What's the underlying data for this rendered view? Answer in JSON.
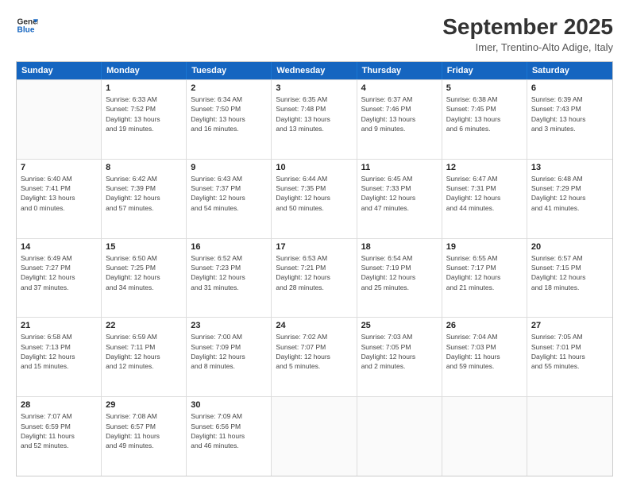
{
  "header": {
    "logo_line1": "General",
    "logo_line2": "Blue",
    "title": "September 2025",
    "subtitle": "Imer, Trentino-Alto Adige, Italy"
  },
  "weekdays": [
    "Sunday",
    "Monday",
    "Tuesday",
    "Wednesday",
    "Thursday",
    "Friday",
    "Saturday"
  ],
  "rows": [
    [
      {
        "day": "",
        "info": ""
      },
      {
        "day": "1",
        "info": "Sunrise: 6:33 AM\nSunset: 7:52 PM\nDaylight: 13 hours\nand 19 minutes."
      },
      {
        "day": "2",
        "info": "Sunrise: 6:34 AM\nSunset: 7:50 PM\nDaylight: 13 hours\nand 16 minutes."
      },
      {
        "day": "3",
        "info": "Sunrise: 6:35 AM\nSunset: 7:48 PM\nDaylight: 13 hours\nand 13 minutes."
      },
      {
        "day": "4",
        "info": "Sunrise: 6:37 AM\nSunset: 7:46 PM\nDaylight: 13 hours\nand 9 minutes."
      },
      {
        "day": "5",
        "info": "Sunrise: 6:38 AM\nSunset: 7:45 PM\nDaylight: 13 hours\nand 6 minutes."
      },
      {
        "day": "6",
        "info": "Sunrise: 6:39 AM\nSunset: 7:43 PM\nDaylight: 13 hours\nand 3 minutes."
      }
    ],
    [
      {
        "day": "7",
        "info": "Sunrise: 6:40 AM\nSunset: 7:41 PM\nDaylight: 13 hours\nand 0 minutes."
      },
      {
        "day": "8",
        "info": "Sunrise: 6:42 AM\nSunset: 7:39 PM\nDaylight: 12 hours\nand 57 minutes."
      },
      {
        "day": "9",
        "info": "Sunrise: 6:43 AM\nSunset: 7:37 PM\nDaylight: 12 hours\nand 54 minutes."
      },
      {
        "day": "10",
        "info": "Sunrise: 6:44 AM\nSunset: 7:35 PM\nDaylight: 12 hours\nand 50 minutes."
      },
      {
        "day": "11",
        "info": "Sunrise: 6:45 AM\nSunset: 7:33 PM\nDaylight: 12 hours\nand 47 minutes."
      },
      {
        "day": "12",
        "info": "Sunrise: 6:47 AM\nSunset: 7:31 PM\nDaylight: 12 hours\nand 44 minutes."
      },
      {
        "day": "13",
        "info": "Sunrise: 6:48 AM\nSunset: 7:29 PM\nDaylight: 12 hours\nand 41 minutes."
      }
    ],
    [
      {
        "day": "14",
        "info": "Sunrise: 6:49 AM\nSunset: 7:27 PM\nDaylight: 12 hours\nand 37 minutes."
      },
      {
        "day": "15",
        "info": "Sunrise: 6:50 AM\nSunset: 7:25 PM\nDaylight: 12 hours\nand 34 minutes."
      },
      {
        "day": "16",
        "info": "Sunrise: 6:52 AM\nSunset: 7:23 PM\nDaylight: 12 hours\nand 31 minutes."
      },
      {
        "day": "17",
        "info": "Sunrise: 6:53 AM\nSunset: 7:21 PM\nDaylight: 12 hours\nand 28 minutes."
      },
      {
        "day": "18",
        "info": "Sunrise: 6:54 AM\nSunset: 7:19 PM\nDaylight: 12 hours\nand 25 minutes."
      },
      {
        "day": "19",
        "info": "Sunrise: 6:55 AM\nSunset: 7:17 PM\nDaylight: 12 hours\nand 21 minutes."
      },
      {
        "day": "20",
        "info": "Sunrise: 6:57 AM\nSunset: 7:15 PM\nDaylight: 12 hours\nand 18 minutes."
      }
    ],
    [
      {
        "day": "21",
        "info": "Sunrise: 6:58 AM\nSunset: 7:13 PM\nDaylight: 12 hours\nand 15 minutes."
      },
      {
        "day": "22",
        "info": "Sunrise: 6:59 AM\nSunset: 7:11 PM\nDaylight: 12 hours\nand 12 minutes."
      },
      {
        "day": "23",
        "info": "Sunrise: 7:00 AM\nSunset: 7:09 PM\nDaylight: 12 hours\nand 8 minutes."
      },
      {
        "day": "24",
        "info": "Sunrise: 7:02 AM\nSunset: 7:07 PM\nDaylight: 12 hours\nand 5 minutes."
      },
      {
        "day": "25",
        "info": "Sunrise: 7:03 AM\nSunset: 7:05 PM\nDaylight: 12 hours\nand 2 minutes."
      },
      {
        "day": "26",
        "info": "Sunrise: 7:04 AM\nSunset: 7:03 PM\nDaylight: 11 hours\nand 59 minutes."
      },
      {
        "day": "27",
        "info": "Sunrise: 7:05 AM\nSunset: 7:01 PM\nDaylight: 11 hours\nand 55 minutes."
      }
    ],
    [
      {
        "day": "28",
        "info": "Sunrise: 7:07 AM\nSunset: 6:59 PM\nDaylight: 11 hours\nand 52 minutes."
      },
      {
        "day": "29",
        "info": "Sunrise: 7:08 AM\nSunset: 6:57 PM\nDaylight: 11 hours\nand 49 minutes."
      },
      {
        "day": "30",
        "info": "Sunrise: 7:09 AM\nSunset: 6:56 PM\nDaylight: 11 hours\nand 46 minutes."
      },
      {
        "day": "",
        "info": ""
      },
      {
        "day": "",
        "info": ""
      },
      {
        "day": "",
        "info": ""
      },
      {
        "day": "",
        "info": ""
      }
    ]
  ]
}
